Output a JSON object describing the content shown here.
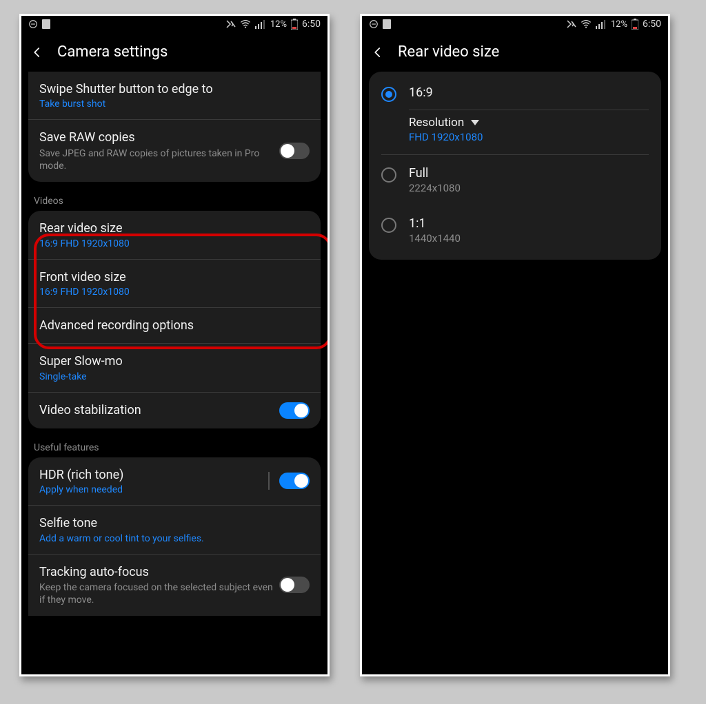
{
  "status": {
    "battery_pct": "12%",
    "time": "6:50"
  },
  "left": {
    "header_title": "Camera settings",
    "swipe": {
      "title": "Swipe Shutter button to edge to",
      "sub": "Take burst shot"
    },
    "raw": {
      "title": "Save RAW copies",
      "sub": "Save JPEG and RAW copies of pictures taken in Pro mode."
    },
    "section_videos": "Videos",
    "rear": {
      "title": "Rear video size",
      "sub": "16:9 FHD 1920x1080"
    },
    "front": {
      "title": "Front video size",
      "sub": "16:9 FHD 1920x1080"
    },
    "advanced": "Advanced recording options",
    "slowmo": {
      "title": "Super Slow-mo",
      "sub": "Single-take"
    },
    "stab": "Video stabilization",
    "section_useful": "Useful features",
    "hdr": {
      "title": "HDR (rich tone)",
      "sub": "Apply when needed"
    },
    "selfie": {
      "title": "Selfie tone",
      "sub": "Add a warm or cool tint to your selfies."
    },
    "track": {
      "title": "Tracking auto-focus",
      "sub": "Keep the camera focused on the selected subject even if they move."
    }
  },
  "right": {
    "header_title": "Rear video size",
    "opt1": {
      "label": "16:9",
      "res_label": "Resolution",
      "res_value": "FHD 1920x1080"
    },
    "opt2": {
      "label": "Full",
      "sub": "2224x1080"
    },
    "opt3": {
      "label": "1:1",
      "sub": "1440x1440"
    }
  }
}
